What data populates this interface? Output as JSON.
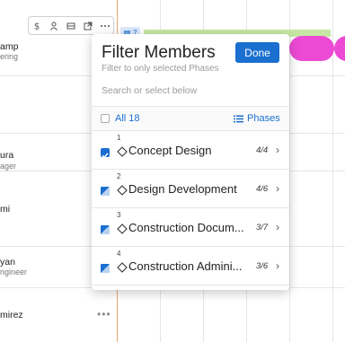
{
  "background": {
    "rows": [
      {
        "name": "amp",
        "role": "ering"
      },
      {
        "name": "ura",
        "role": "ager"
      },
      {
        "name": "mi",
        "role": ""
      },
      {
        "name": "yan",
        "role": "ngineer"
      },
      {
        "name": "mirez",
        "role": ""
      }
    ],
    "phase_chip_label": "7",
    "row_toolbar_icons": [
      "dollar-icon",
      "person-icon",
      "card-icon",
      "external-link-icon",
      "more-icon"
    ],
    "more_label": "•••"
  },
  "popover": {
    "title": "Filter Members",
    "subtitle": "Filter to only selected Phases",
    "done_label": "Done",
    "search_placeholder": "Search or select below",
    "all_label": "All 18",
    "phases_toggle_label": "Phases",
    "phases": [
      {
        "index": "1",
        "name": "Concept Design",
        "count": "4/4",
        "state": "full"
      },
      {
        "index": "2",
        "name": "Design Development",
        "count": "4/6",
        "state": "partial"
      },
      {
        "index": "3",
        "name": "Construction Docum...",
        "count": "3/7",
        "state": "partial"
      },
      {
        "index": "4",
        "name": "Construction Admini...",
        "count": "3/6",
        "state": "partial"
      }
    ]
  },
  "colors": {
    "accent": "#1a6fd0",
    "today_line": "#e6a86a",
    "bar_green": "#c6e7a4",
    "bar_pink": "#ec4ad5"
  }
}
